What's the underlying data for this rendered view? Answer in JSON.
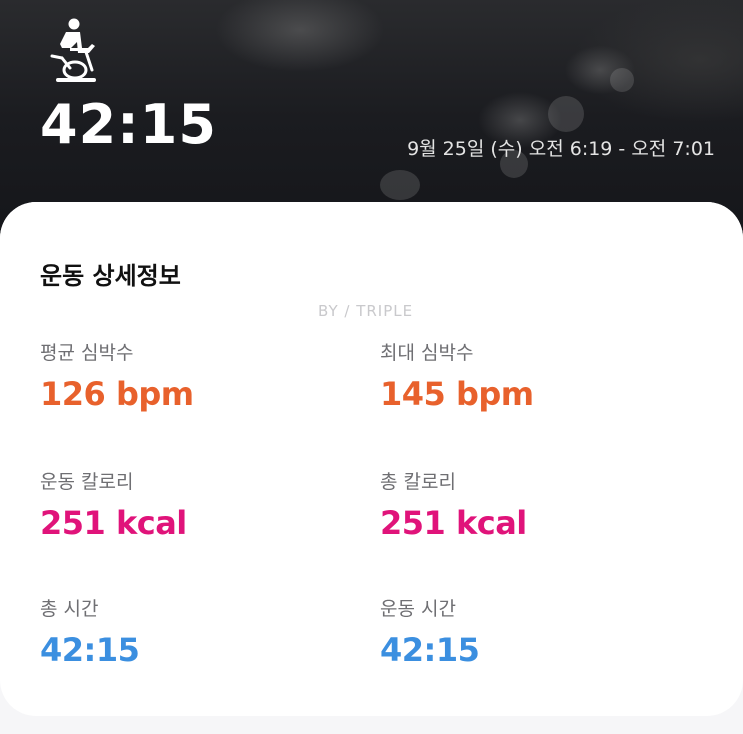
{
  "header": {
    "activity_icon": "stationary-bike-icon",
    "duration": "42:15",
    "date_range": "9월 25일 (수) 오전 6:19 - 오전 7:01"
  },
  "details": {
    "title": "운동 상세정보",
    "watermark": "BY ∕ TRIPLE",
    "avg_heart_rate": {
      "label": "평균 심박수",
      "value": "126 bpm",
      "color": "#e8612c"
    },
    "max_heart_rate": {
      "label": "최대 심박수",
      "value": "145 bpm",
      "color": "#e8612c"
    },
    "workout_calories": {
      "label": "운동 칼로리",
      "value": "251 kcal",
      "color": "#e0137a"
    },
    "total_calories": {
      "label": "총 칼로리",
      "value": "251 kcal",
      "color": "#e0137a"
    },
    "total_time": {
      "label": "총 시간",
      "value": "42:15",
      "color": "#3b8fe0"
    },
    "workout_time": {
      "label": "운동 시간",
      "value": "42:15",
      "color": "#3b8fe0"
    }
  }
}
